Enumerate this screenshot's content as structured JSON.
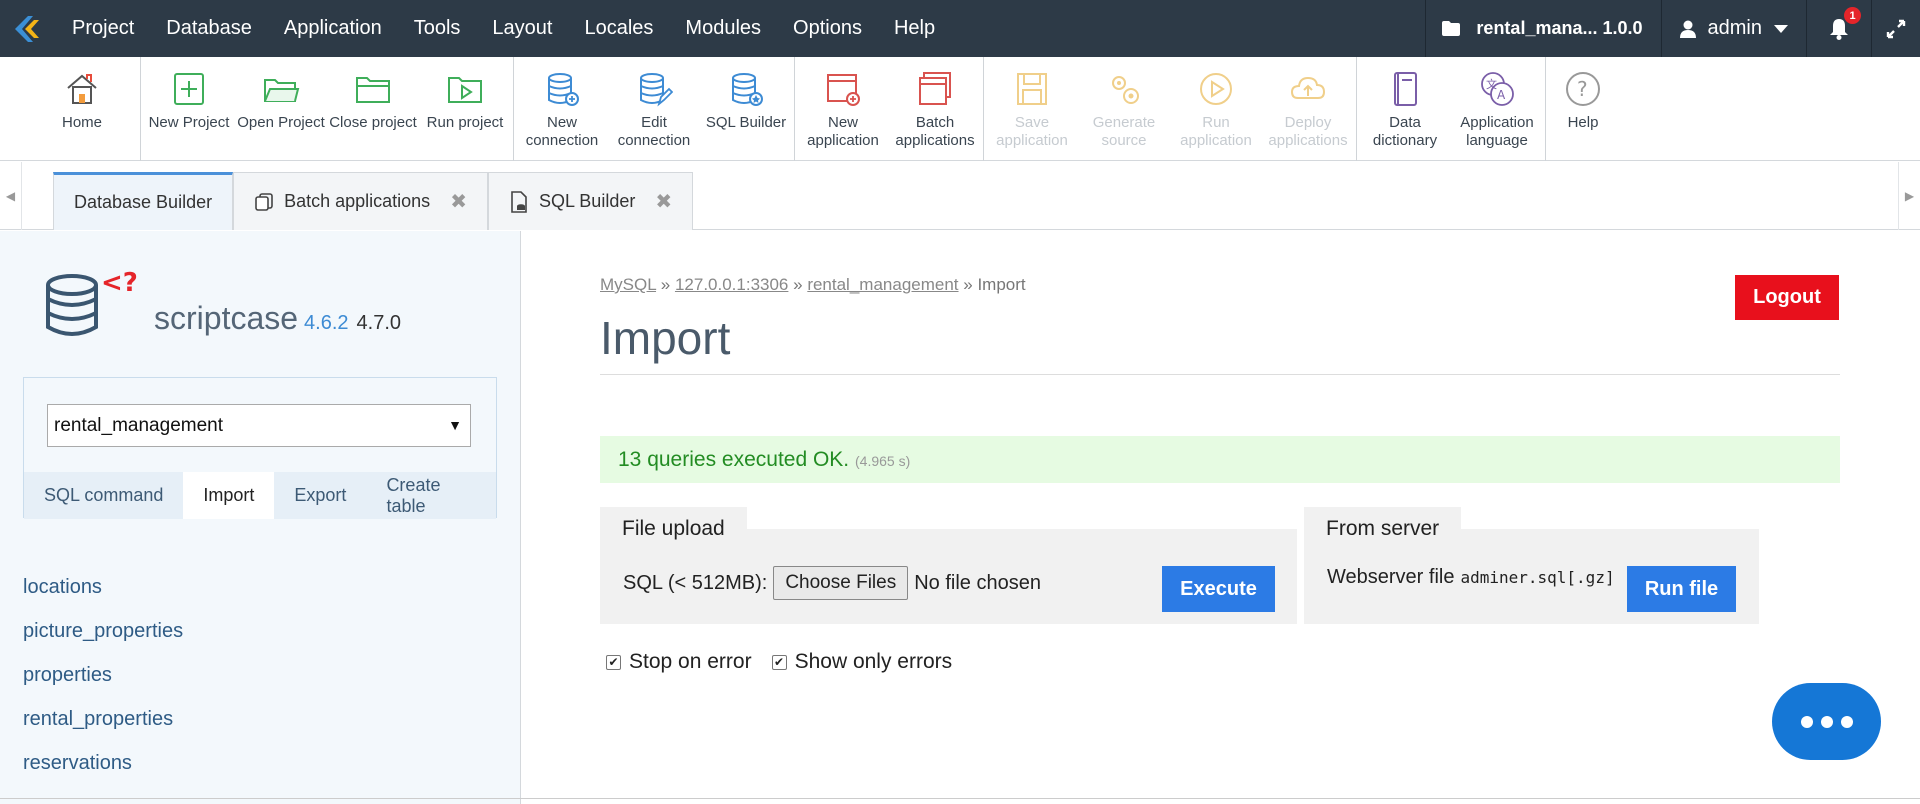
{
  "menu": [
    "Project",
    "Database",
    "Application",
    "Tools",
    "Layout",
    "Locales",
    "Modules",
    "Options",
    "Help"
  ],
  "header": {
    "project_name": "rental_mana... 1.0.0",
    "user": "admin",
    "notifications": "1"
  },
  "toolbar": {
    "home": "Home",
    "new_project": "New Project",
    "open_project": "Open Project",
    "close_project": "Close project",
    "run_project": "Run project",
    "new_connection": "New connection",
    "edit_connection": "Edit connection",
    "sql_builder": "SQL Builder",
    "new_application": "New application",
    "batch_applications": "Batch applications",
    "save_application": "Save application",
    "generate_source": "Generate source",
    "run_application": "Run application",
    "deploy_applications": "Deploy applications",
    "data_dictionary": "Data dictionary",
    "application_language": "Application language",
    "help": "Help"
  },
  "tabs": [
    "Database Builder",
    "Batch applications",
    "SQL Builder"
  ],
  "sidebar": {
    "brand": "scriptcase",
    "version_a": "4.6.2",
    "version_b": "4.7.0",
    "database": "rental_management",
    "links": [
      "SQL command",
      "Import",
      "Export",
      "Create table"
    ],
    "tables": [
      "locations",
      "picture_properties",
      "properties",
      "rental_properties",
      "reservations"
    ]
  },
  "main": {
    "breadcrumb": [
      "MySQL",
      "127.0.0.1:3306",
      "rental_management",
      "Import"
    ],
    "title": "Import",
    "logout": "Logout",
    "message": "13 queries executed OK.",
    "message_time": "(4.965 s)",
    "file_upload": {
      "legend": "File upload",
      "label": "SQL (< 512MB):",
      "choose": "Choose Files",
      "no_file": "No file chosen",
      "execute": "Execute"
    },
    "from_server": {
      "legend": "From server",
      "label": "Webserver file",
      "file": "adminer.sql[.gz]",
      "run": "Run file"
    },
    "stop_on_error": "Stop on error",
    "show_only_errors": "Show only errors"
  },
  "colors": {
    "menubar": "#2d3a47",
    "accent_blue": "#2c7be5",
    "logout_red": "#e8101c",
    "success_bg": "#e6fbe2"
  }
}
